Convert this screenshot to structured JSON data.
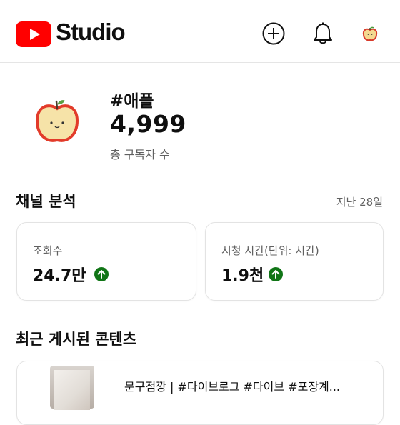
{
  "header": {
    "brand": "Studio",
    "icons": [
      "youtube-logo-icon",
      "create-plus-icon",
      "notifications-bell-icon",
      "account-avatar"
    ]
  },
  "channel": {
    "name": "#애플",
    "subscribers": "4,999",
    "subscribers_label": "총 구독자 수"
  },
  "analytics": {
    "title": "채널 분석",
    "period": "지난 28일",
    "metrics": [
      {
        "label": "조회수",
        "value": "24.7만",
        "trend": "up"
      },
      {
        "label": "시청 시간(단위: 시간)",
        "value": "1.9천",
        "trend": "up"
      }
    ]
  },
  "recent": {
    "title": "최근 게시된 콘텐츠",
    "items": [
      {
        "title": "문구점깡 | #다이브로그 #다이브 #포장계..."
      }
    ]
  },
  "colors": {
    "brand_red": "#ff0000",
    "trend_green": "#107516",
    "text_primary": "#0f0f0f",
    "text_secondary": "#606060"
  }
}
